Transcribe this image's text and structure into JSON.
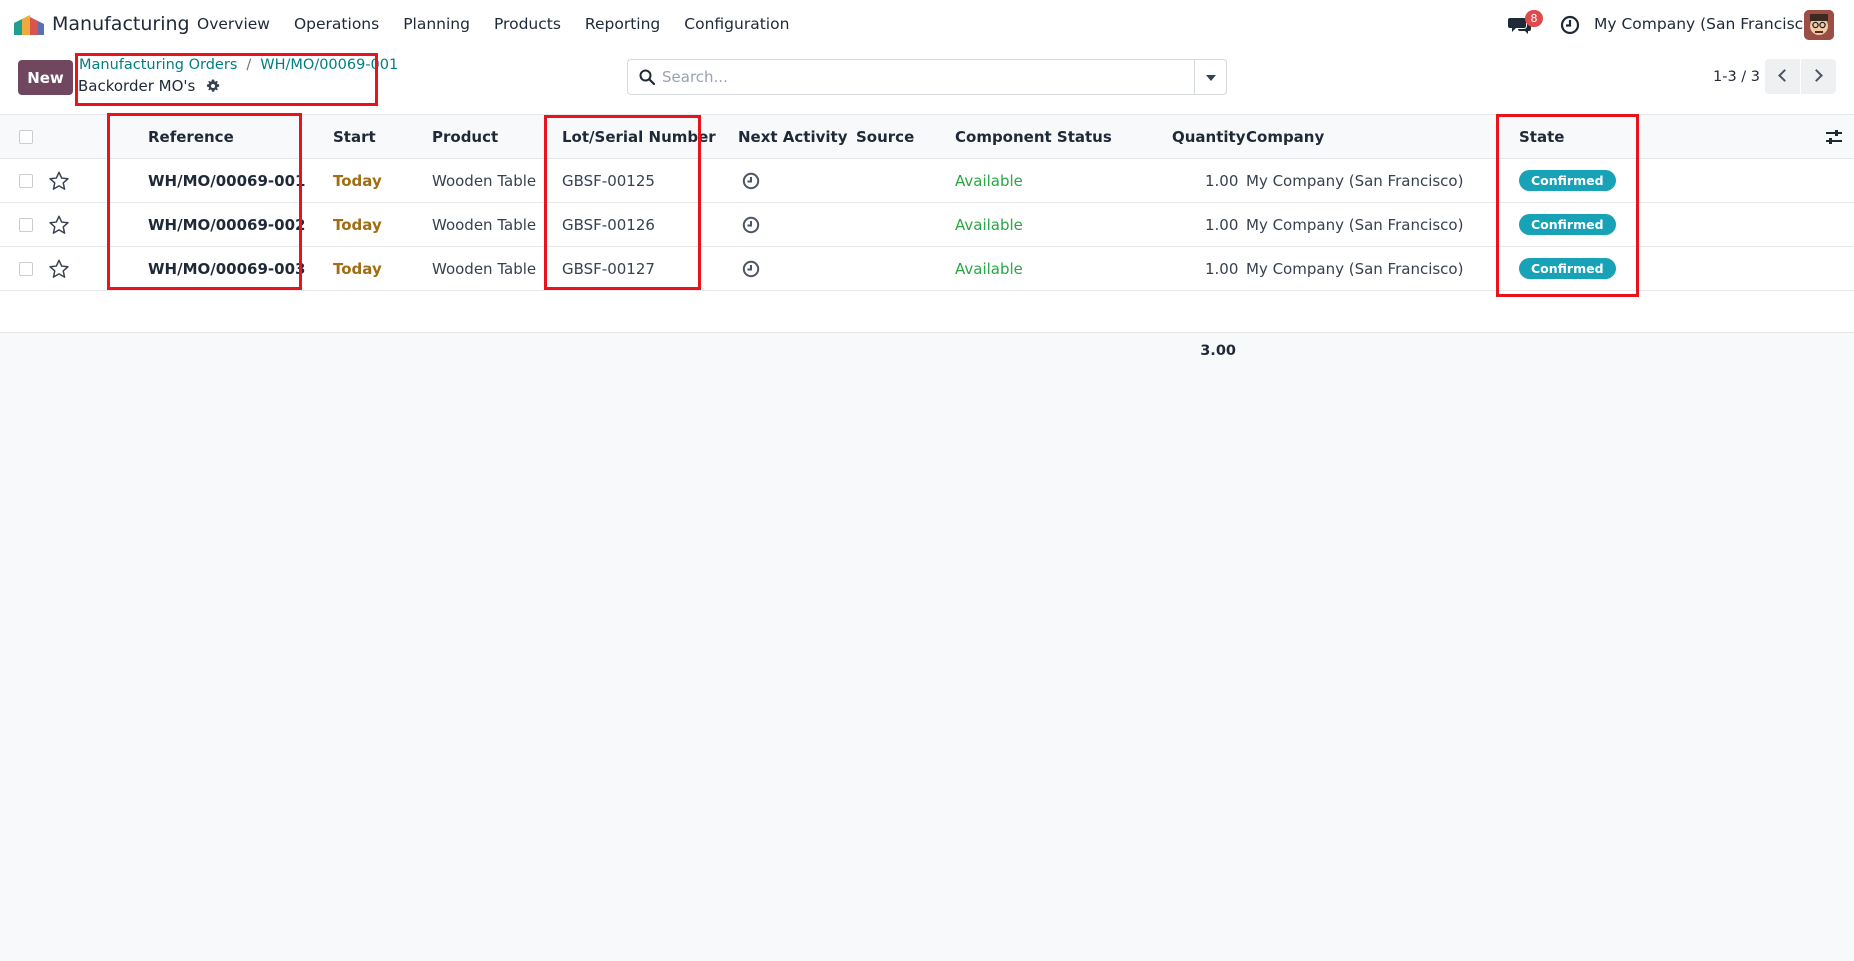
{
  "app": {
    "name": "Manufacturing"
  },
  "menu": [
    "Overview",
    "Operations",
    "Planning",
    "Products",
    "Reporting",
    "Configuration"
  ],
  "nav": {
    "chat_badge": "8",
    "company": "My Company (San Francisco)"
  },
  "control": {
    "new_label": "New",
    "breadcrumb": [
      "Manufacturing Orders",
      "WH/MO/00069-001"
    ],
    "subtitle": "Backorder MO's",
    "search_placeholder": "Search...",
    "pager": "1-3 / 3"
  },
  "table": {
    "columns": [
      "Reference",
      "Start",
      "Product",
      "Lot/Serial Number",
      "Next Activity",
      "Source",
      "Component Status",
      "Quantity",
      "Company",
      "State"
    ],
    "rows": [
      {
        "reference": "WH/MO/00069-001",
        "start": "Today",
        "product": "Wooden Table",
        "lot": "GBSF-00125",
        "source": "",
        "component_status": "Available",
        "quantity": "1.00",
        "company": "My Company (San Francisco)",
        "state": "Confirmed"
      },
      {
        "reference": "WH/MO/00069-002",
        "start": "Today",
        "product": "Wooden Table",
        "lot": "GBSF-00126",
        "source": "",
        "component_status": "Available",
        "quantity": "1.00",
        "company": "My Company (San Francisco)",
        "state": "Confirmed"
      },
      {
        "reference": "WH/MO/00069-003",
        "start": "Today",
        "product": "Wooden Table",
        "lot": "GBSF-00127",
        "source": "",
        "component_status": "Available",
        "quantity": "1.00",
        "company": "My Company (San Francisco)",
        "state": "Confirmed"
      }
    ],
    "total_quantity": "3.00"
  },
  "colors": {
    "brand": "#71475f",
    "link": "#017e84",
    "today": "#a16d12",
    "available": "#28a745",
    "badge": "#17a2b8",
    "highlight": "#e8131c"
  },
  "icons": [
    "app-logo-icon",
    "chat-icon",
    "clock-icon",
    "gear-icon",
    "search-icon",
    "chevron-down-icon",
    "chevron-left-icon",
    "chevron-right-icon",
    "star-icon",
    "activity-clock-icon",
    "optional-columns-icon"
  ]
}
